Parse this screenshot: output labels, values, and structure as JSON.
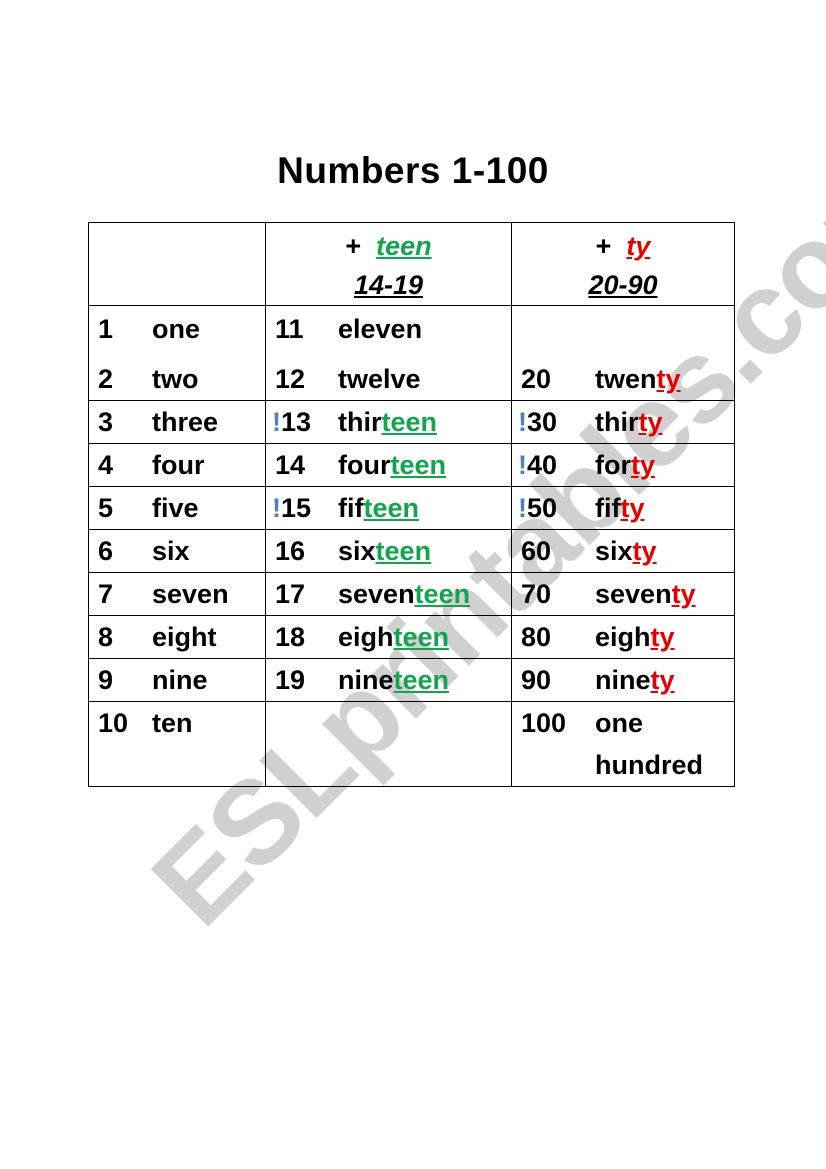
{
  "title": "Numbers 1-100",
  "watermark": "ESLprintables.com",
  "colors": {
    "teen": "#14a44d",
    "ty": "#e50000",
    "exclamation": "#4f81bd",
    "text": "#000000",
    "watermark": "#d0d0d0"
  },
  "header": {
    "col2": {
      "plus": "+",
      "suffix": "teen",
      "range": "14-19"
    },
    "col3": {
      "plus": "+",
      "suffix": "ty",
      "range": "20-90"
    }
  },
  "rows": [
    {
      "ones": [
        {
          "num": "1",
          "word": "one"
        },
        {
          "num": "2",
          "word": "two"
        }
      ],
      "teens": [
        {
          "num": "11",
          "word": "eleven",
          "stem": "eleven",
          "suffix": ""
        },
        {
          "num": "12",
          "word": "twelve",
          "stem": "twelve",
          "suffix": ""
        }
      ],
      "tens": [
        {
          "num": "",
          "stem": "",
          "suffix": ""
        },
        {
          "num": "20",
          "stem": "twen",
          "suffix": "ty"
        }
      ]
    },
    {
      "ones": {
        "num": "3",
        "word": "three"
      },
      "teens": {
        "excl": "!",
        "num": "13",
        "stem": "thir",
        "suffix": "teen"
      },
      "tens": {
        "excl": "!",
        "num": "30",
        "stem": "thir",
        "suffix": "ty"
      }
    },
    {
      "ones": {
        "num": "4",
        "word": "four"
      },
      "teens": {
        "num": "14",
        "stem": "four",
        "suffix": "teen"
      },
      "tens": {
        "excl": "!",
        "num": "40",
        "stem": "for",
        "suffix": "ty"
      }
    },
    {
      "ones": {
        "num": "5",
        "word": "five"
      },
      "teens": {
        "excl": "!",
        "num": "15",
        "stem": "fif",
        "suffix": "teen"
      },
      "tens": {
        "excl": "!",
        "num": "50",
        "stem": "fif",
        "suffix": "ty"
      }
    },
    {
      "ones": {
        "num": "6",
        "word": "six"
      },
      "teens": {
        "num": "16",
        "stem": "six",
        "suffix": "teen"
      },
      "tens": {
        "num": "60",
        "stem": "six",
        "suffix": "ty"
      }
    },
    {
      "ones": {
        "num": "7",
        "word": "seven"
      },
      "teens": {
        "num": "17",
        "stem": "seven",
        "suffix": "teen"
      },
      "tens": {
        "num": "70",
        "stem": "seven",
        "suffix": "ty"
      }
    },
    {
      "ones": {
        "num": "8",
        "word": "eight"
      },
      "teens": {
        "num": "18",
        "stem": "eigh",
        "suffix": "teen"
      },
      "tens": {
        "num": "80",
        "stem": "eigh",
        "suffix": "ty"
      }
    },
    {
      "ones": {
        "num": "9",
        "word": "nine"
      },
      "teens": {
        "num": "19",
        "stem": "nine",
        "suffix": "teen"
      },
      "tens": {
        "num": "90",
        "stem": "nine",
        "suffix": "ty"
      }
    },
    {
      "ones": {
        "num": "10",
        "word": "ten"
      },
      "teens": {
        "num": "",
        "stem": "",
        "suffix": ""
      },
      "tens": {
        "num": "100",
        "word_line1": "one",
        "word_line2": "hundred"
      }
    }
  ]
}
